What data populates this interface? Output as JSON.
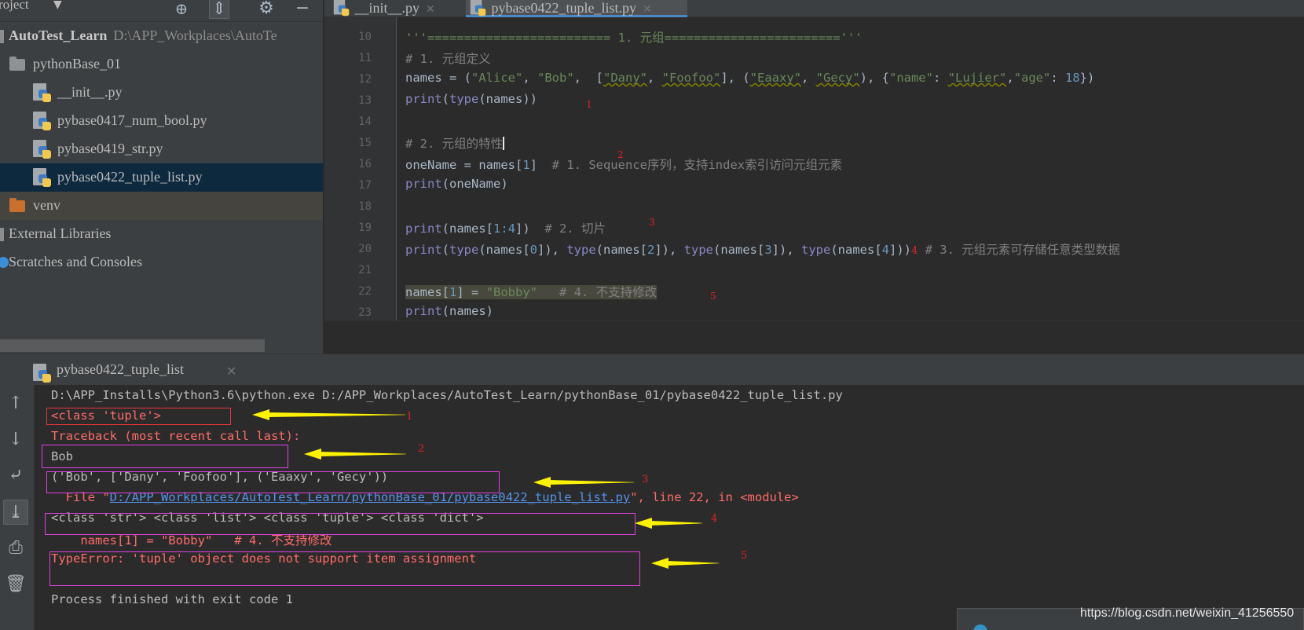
{
  "sidebar": {
    "title": "roject",
    "root": {
      "name": "AutoTest_Learn",
      "path": "D:\\APP_Workplaces\\AutoTe"
    },
    "folder": "pythonBase_01",
    "files": [
      "__init__.py",
      "pybase0417_num_bool.py",
      "pybase0419_str.py",
      "pybase0422_tuple_list.py"
    ],
    "venv": "venv",
    "external": "External Libraries",
    "scratches": "Scratches and Consoles"
  },
  "editor": {
    "tabs": [
      {
        "label": "__init__.py"
      },
      {
        "label": "pybase0422_tuple_list.py"
      }
    ],
    "line_numbers": [
      "10",
      "11",
      "12",
      "13",
      "14",
      "15",
      "16",
      "17",
      "18",
      "19",
      "20",
      "21",
      "22",
      "23"
    ],
    "annotations": [
      "1",
      "2",
      "3",
      "4",
      "5"
    ]
  },
  "run": {
    "tab": "pybase0422_tuple_list",
    "lines": {
      "cmd": "D:\\APP_Installs\\Python3.6\\python.exe D:/APP_Workplaces/AutoTest_Learn/pythonBase_01/pybase0422_tuple_list.py",
      "l1": "<class 'tuple'>",
      "tb": "Traceback (most recent call last):",
      "bob": "Bob",
      "slice": "('Bob', ['Dany', 'Foofoo'], ('Eaaxy', 'Gecy'))",
      "file_prefix": "  File \"",
      "file_link": "D:/APP_Workplaces/AutoTest_Learn/pythonBase_01/pybase0422_tuple_list.py",
      "file_suffix": "\", line 22, in <module>",
      "types": "<class 'str'> <class 'list'> <class 'tuple'> <class 'dict'>",
      "src": "    names[1] = \"Bobby\"   # 4. 不支持修改",
      "error": "TypeError: 'tuple' object does not support item assignment",
      "exit": "Process finished with exit code 1"
    },
    "annotations": [
      "1",
      "2",
      "3",
      "4",
      "5"
    ]
  },
  "watermark": "https://blog.csdn.net/weixin_41256550",
  "colors": {
    "sidebar_bg": "#3c3f41",
    "editor_bg": "#2b2b2b",
    "selection": "#0d293e",
    "error_red": "#ff6b68",
    "link_blue": "#5394ec",
    "annotation_yellow": "#fff200",
    "box_magenta": "#e040e0",
    "box_red": "#e8343a"
  }
}
